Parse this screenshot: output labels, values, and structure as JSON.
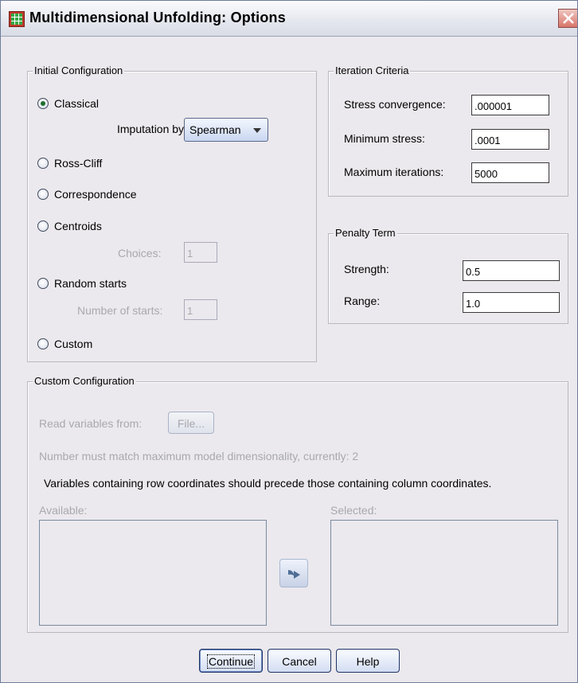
{
  "window": {
    "title": "Multidimensional Unfolding: Options"
  },
  "initial_config": {
    "legend": "Initial Configuration",
    "options": [
      {
        "label": "Classical",
        "selected": true
      },
      {
        "label": "Ross-Cliff",
        "selected": false
      },
      {
        "label": "Correspondence",
        "selected": false
      },
      {
        "label": "Centroids",
        "selected": false
      },
      {
        "label": "Random starts",
        "selected": false
      },
      {
        "label": "Custom",
        "selected": false
      }
    ],
    "imputation_label": "Imputation by:",
    "imputation_value": "Spearman",
    "choices_label": "Choices:",
    "choices_value": "1",
    "num_starts_label": "Number of starts:",
    "num_starts_value": "1"
  },
  "iteration": {
    "legend": "Iteration Criteria",
    "stress_conv_label": "Stress convergence:",
    "stress_conv_value": ".000001",
    "min_stress_label": "Minimum stress:",
    "min_stress_value": ".0001",
    "max_iter_label": "Maximum iterations:",
    "max_iter_value": "5000"
  },
  "penalty": {
    "legend": "Penalty Term",
    "strength_label": "Strength:",
    "strength_value": "0.5",
    "range_label": "Range:",
    "range_value": "1.0"
  },
  "custom_config": {
    "legend": "Custom Configuration",
    "read_vars_label": "Read variables from:",
    "file_button": "File...",
    "dim_note": "Number must match maximum model dimensionality, currently:  2",
    "vars_note": "Variables containing row coordinates should precede those containing column coordinates.",
    "available_label": "Available:",
    "selected_label": "Selected:"
  },
  "buttons": {
    "continue": "Continue",
    "cancel": "Cancel",
    "help": "Help"
  }
}
